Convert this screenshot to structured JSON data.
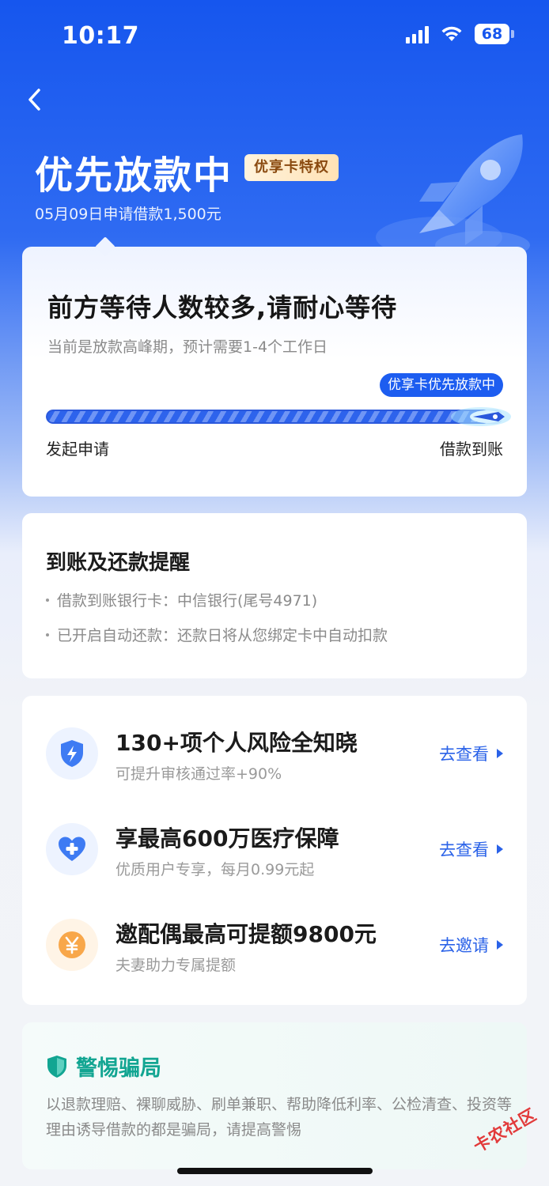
{
  "status_bar": {
    "time": "10:17",
    "battery": "68"
  },
  "header": {
    "title": "优先放款中",
    "badge": "优享卡特权",
    "subtitle": "05月09日申请借款1,500元"
  },
  "progress_card": {
    "title": "前方等待人数较多,请耐心等待",
    "description": "当前是放款高峰期，预计需要1-4个工作日",
    "tag": "优享卡优先放款中",
    "start_label": "发起申请",
    "end_label": "借款到账",
    "progress_fraction": 0.97
  },
  "reminder": {
    "title": "到账及还款提醒",
    "items": [
      "借款到账银行卡：中信银行(尾号4971)",
      "已开启自动还款：还款日将从您绑定卡中自动扣款"
    ]
  },
  "services": [
    {
      "title": "130+项个人风险全知晓",
      "subtitle": "可提升审核通过率+90%",
      "action": "去查看",
      "icon": "shield-bolt-icon"
    },
    {
      "title": "享最高600万医疗保障",
      "subtitle": "优质用户专享，每月0.99元起",
      "action": "去查看",
      "icon": "heart-plus-icon"
    },
    {
      "title": "邀配偶最高可提额9800元",
      "subtitle": "夫妻助力专属提额",
      "action": "去邀请",
      "icon": "yuan-coin-icon"
    }
  ],
  "warning": {
    "title": "警惕骗局",
    "text": "以退款理赔、裸聊威胁、刷单兼职、帮助降低利率、公检清查、投资等理由诱导借款的都是骗局，请提高警惕"
  },
  "watermark": "卡农社区",
  "colors": {
    "primary": "#1d5df0",
    "accent_green": "#12a592",
    "badge_gold": "#8a4a10"
  }
}
